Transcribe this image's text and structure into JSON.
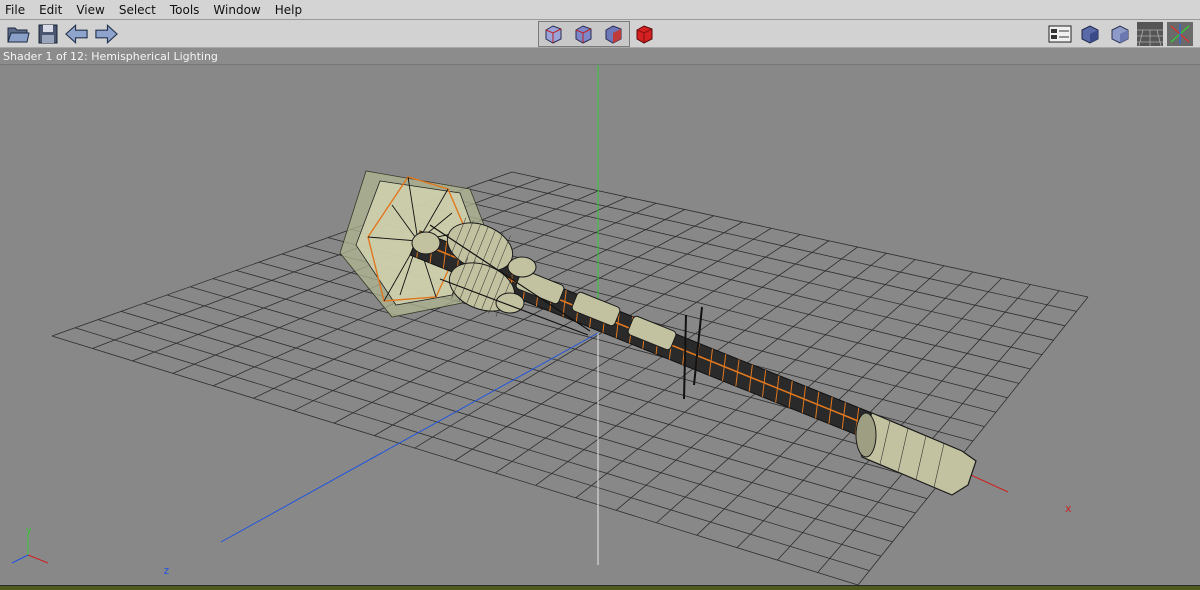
{
  "menubar": {
    "items": [
      "File",
      "Edit",
      "View",
      "Select",
      "Tools",
      "Window",
      "Help"
    ]
  },
  "toolbar": {
    "left_icons": [
      "open-folder-icon",
      "save-icon",
      "back-arrow-icon",
      "forward-arrow-icon"
    ],
    "view_icons": [
      "wireframe-cube-icon",
      "shaded-wireframe-cube-icon",
      "flat-cube-icon",
      "solid-red-cube-icon"
    ],
    "right_icons": [
      "properties-panel-icon",
      "shaded-cube-icon",
      "light-cube-icon",
      "grid-toggle-icon",
      "axes-toggle-icon"
    ]
  },
  "status": {
    "text": "Shader 1 of 12: Hemispherical Lighting"
  },
  "viewport": {
    "axis_labels": {
      "x": "x",
      "y": "y",
      "z": "z"
    },
    "colors": {
      "background": "#888888",
      "grid": "#2e2e2e",
      "x_axis": "#cc2222",
      "y_axis": "#33cc33",
      "z_axis": "#2255dd",
      "hull": "#c2c2a0",
      "truss": "#e07820"
    }
  }
}
